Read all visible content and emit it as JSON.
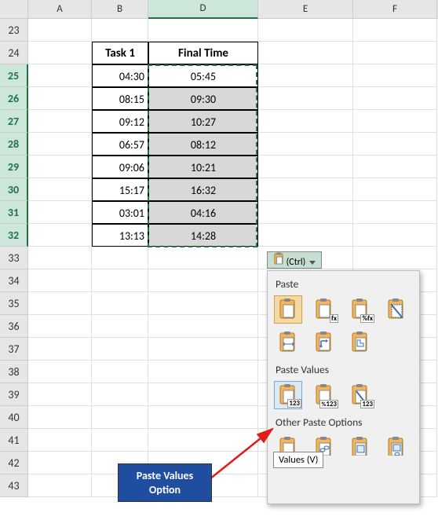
{
  "columns": {
    "A": "A",
    "B": "B",
    "D": "D",
    "E": "E",
    "F": "F"
  },
  "row_start": 23,
  "row_end": 43,
  "selected_rows": [
    25,
    26,
    27,
    28,
    29,
    30,
    31,
    32
  ],
  "active_column": "D",
  "table": {
    "headers": {
      "B": "Task 1",
      "D": "Final Time"
    },
    "rows": [
      {
        "B": "04:30",
        "D": "05:45"
      },
      {
        "B": "08:15",
        "D": "09:30"
      },
      {
        "B": "09:12",
        "D": "10:27"
      },
      {
        "B": "06:57",
        "D": "08:12"
      },
      {
        "B": "09:06",
        "D": "10:21"
      },
      {
        "B": "15:17",
        "D": "16:32"
      },
      {
        "B": "03:01",
        "D": "04:16"
      },
      {
        "B": "13:13",
        "D": "14:28"
      }
    ]
  },
  "ctrl_button": {
    "label": "(Ctrl)"
  },
  "paste_menu": {
    "section_paste": "Paste",
    "section_values": "Paste Values",
    "section_other": "Other Paste Options",
    "tooltip": "Values (V)",
    "icons_paste_row1": [
      {
        "name": "paste",
        "badge": ""
      },
      {
        "name": "paste-formulas",
        "badge": "fx"
      },
      {
        "name": "paste-formulas-number",
        "badge": "%fx"
      },
      {
        "name": "paste-no-borders",
        "badge": ""
      }
    ],
    "icons_paste_row2": [
      {
        "name": "paste-keep-source-width",
        "badge": ""
      },
      {
        "name": "paste-transpose",
        "badge": ""
      },
      {
        "name": "paste-merge-conditional",
        "badge": ""
      }
    ],
    "icons_values": [
      {
        "name": "paste-values",
        "badge": "123"
      },
      {
        "name": "paste-values-number",
        "badge": "123",
        "prefix": "%"
      },
      {
        "name": "paste-values-source",
        "badge": "123"
      }
    ],
    "icons_other": [
      {
        "name": "paste-formatting",
        "badge": "%"
      },
      {
        "name": "paste-link",
        "badge": ""
      },
      {
        "name": "paste-picture",
        "badge": ""
      },
      {
        "name": "paste-linked-picture",
        "badge": ""
      }
    ]
  },
  "callout": {
    "line1": "Paste Values",
    "line2": "Option"
  }
}
